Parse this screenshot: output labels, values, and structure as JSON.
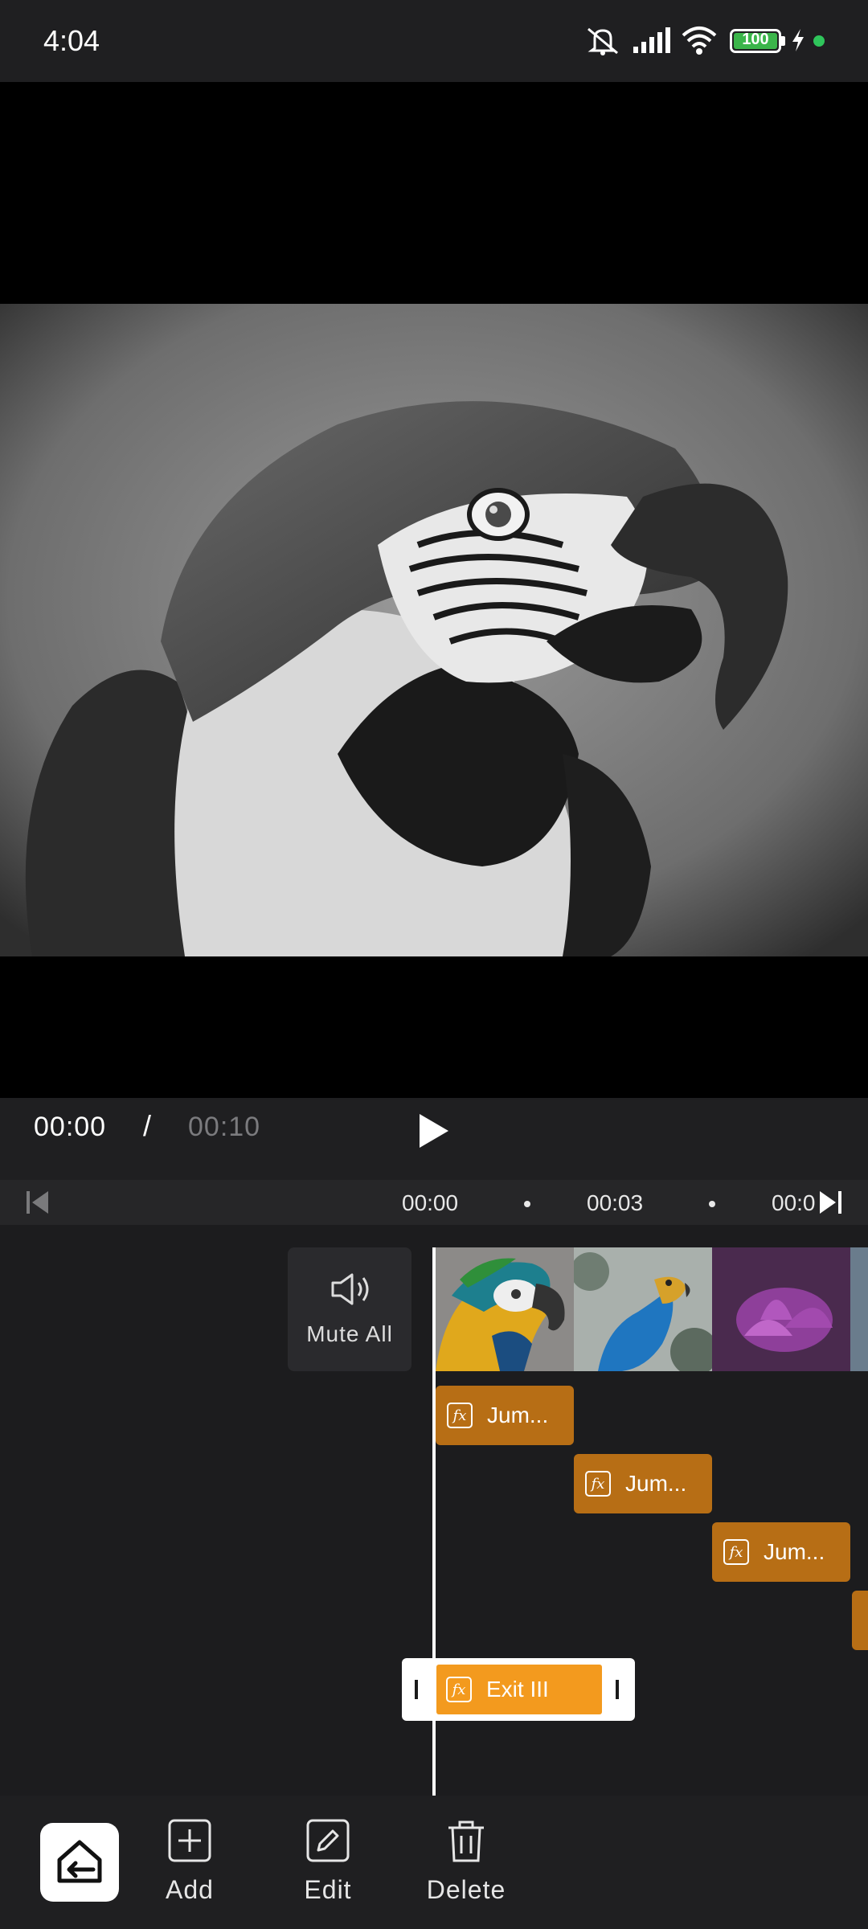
{
  "status_bar": {
    "time": "4:04",
    "battery": "100"
  },
  "playback": {
    "current_time": "00:00",
    "separator": "/",
    "total_time": "00:10"
  },
  "ruler": {
    "ticks": [
      "00:00",
      "00:03",
      "00:0"
    ]
  },
  "timeline": {
    "mute_all_label": "Mute All",
    "effect_clips": [
      "Jum...",
      "Jum...",
      "Jum..."
    ],
    "selected_clip": "Exit III"
  },
  "toolbar": {
    "add_label": "Add",
    "edit_label": "Edit",
    "delete_label": "Delete"
  },
  "colors": {
    "clip": "#b76e15",
    "selected_clip": "#f39a1e",
    "battery": "#3bb54a"
  }
}
